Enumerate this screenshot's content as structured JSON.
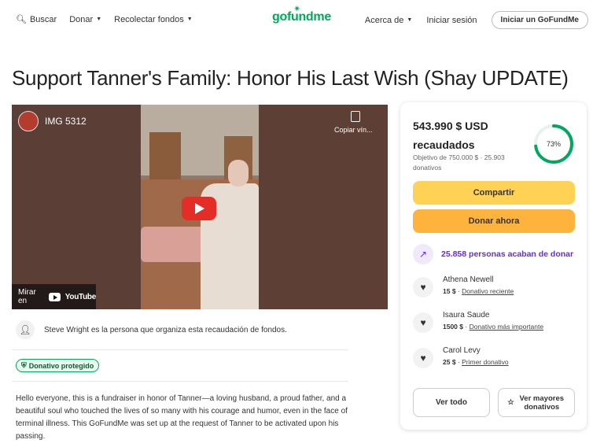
{
  "header": {
    "search_label": "Buscar",
    "donate_label": "Donar",
    "fundraise_label": "Recolectar fondos",
    "logo_text": "gofundme",
    "about_label": "Acerca de",
    "login_label": "Iniciar sesión",
    "start_label": "Iniciar un GoFundMe"
  },
  "title": "Support Tanner's Family: Honor His Last Wish (Shay UPDATE)",
  "video": {
    "title": "IMG 5312",
    "copy_label": "Copiar vín...",
    "watch_label": "Mirar en",
    "youtube_label": "YouTube"
  },
  "organizer": {
    "text": "Steve Wright es la persona que organiza esta recaudación de fondos."
  },
  "badge": {
    "label": "Donativo protegido"
  },
  "story": "Hello everyone, this is a fundraiser in honor of Tanner—a loving husband, a proud father, and a beautiful soul who touched the lives of so many with his courage and humor, even in the face of terminal illness. This GoFundMe was set up at the request of Tanner to be activated upon his passing.",
  "sidebar": {
    "amount": "543.990 $ USD recaudados",
    "goal": "Objetivo de 750.000 $ · 25.903 donativos",
    "progress": 0.73,
    "progress_label": "73%",
    "share_label": "Compartir",
    "donate_label": "Donar ahora",
    "trend_text": "25.858 personas acaban de donar",
    "donors": [
      {
        "name": "Athena Newell",
        "amount": "15 $",
        "tag": "Donativo reciente"
      },
      {
        "name": "Isaura Saude",
        "amount": "1500 $",
        "tag": "Donativo más importante"
      },
      {
        "name": "Carol Levy",
        "amount": "25 $",
        "tag": "Primer donativo"
      }
    ],
    "see_all_label": "Ver todo",
    "top_label": "Ver mayores donativos"
  },
  "colors": {
    "brand": "#02a95c",
    "share": "#ffd154",
    "donate": "#fdb33c",
    "trend": "#6c2bd9"
  }
}
